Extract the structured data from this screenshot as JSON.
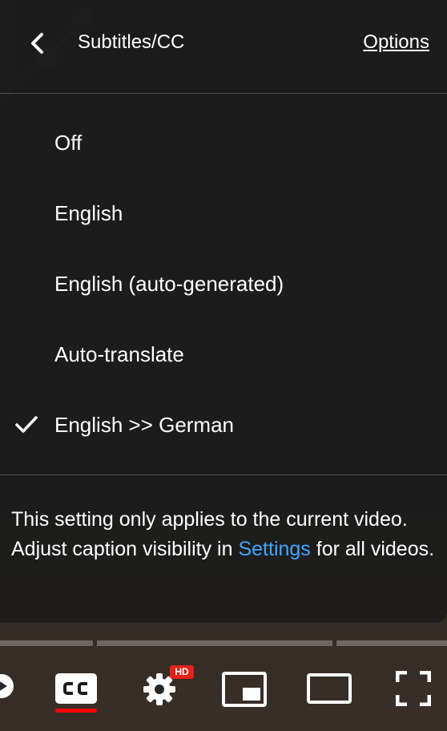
{
  "header": {
    "title": "Subtitles/CC",
    "options_label": "Options"
  },
  "menu": {
    "items": [
      {
        "label": "Off",
        "selected": false
      },
      {
        "label": "English",
        "selected": false
      },
      {
        "label": "English (auto-generated)",
        "selected": false
      },
      {
        "label": "Auto-translate",
        "selected": false
      },
      {
        "label": "English >> German",
        "selected": true
      }
    ]
  },
  "note": {
    "text_before": "This setting only applies to the current video. Adjust caption visibility in ",
    "link_label": "Settings",
    "text_after": " for all videos."
  },
  "controls": {
    "hd_badge": "HD",
    "icons": [
      "play-icon",
      "cc-icon",
      "gear-icon",
      "miniplayer-icon",
      "theater-mode-icon",
      "fullscreen-icon"
    ],
    "cc_active": true
  },
  "colors": {
    "link": "#3ea6ff",
    "accent_red": "#ff0000",
    "hd_badge": "#e62117",
    "panel": "#1c1c1c"
  }
}
